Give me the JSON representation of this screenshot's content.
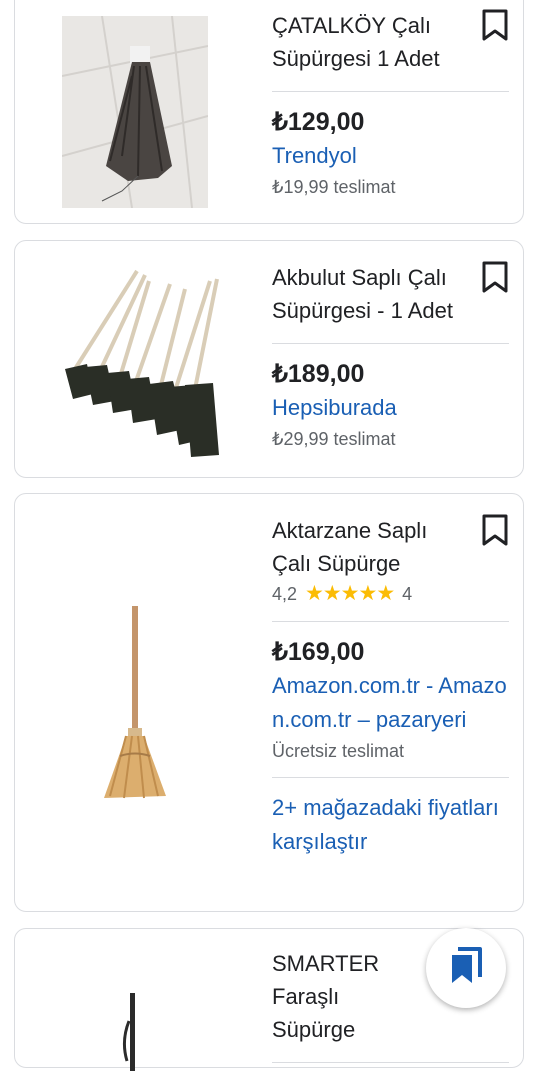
{
  "products": [
    {
      "title": "ÇATALKÖY Çalı Süpürgesi 1 Adet",
      "price": "₺129,00",
      "store": "Trendyol",
      "shipping": "₺19,99 teslimat",
      "image": "broom-bundle-image"
    },
    {
      "title": "Akbulut Saplı Çalı Süpürgesi - 1 Adet",
      "price": "₺189,00",
      "store": "Hepsiburada",
      "shipping": "₺29,99 teslimat",
      "image": "broom-set-image"
    },
    {
      "title": "Aktarzane Saplı Çalı Süpürge",
      "rating_value": "4,2",
      "rating_stars": "★★★★★",
      "rating_count": "4",
      "price": "₺169,00",
      "store": "Amazon.com.tr - Amazon.com.tr – pazaryeri",
      "shipping": "Ücretsiz teslimat",
      "compare": "2+ mağazadaki fiyatları karşılaştır",
      "image": "straw-broom-image"
    },
    {
      "title": "SMARTER Faraşlı Süpürge",
      "image": "dustpan-broom-image"
    }
  ],
  "fab": {
    "icon": "bookmarks-icon"
  },
  "colors": {
    "link": "#1a5fb4",
    "star": "#fbbc04",
    "text": "#202124",
    "muted": "#5f6368",
    "border": "#dadce0"
  }
}
